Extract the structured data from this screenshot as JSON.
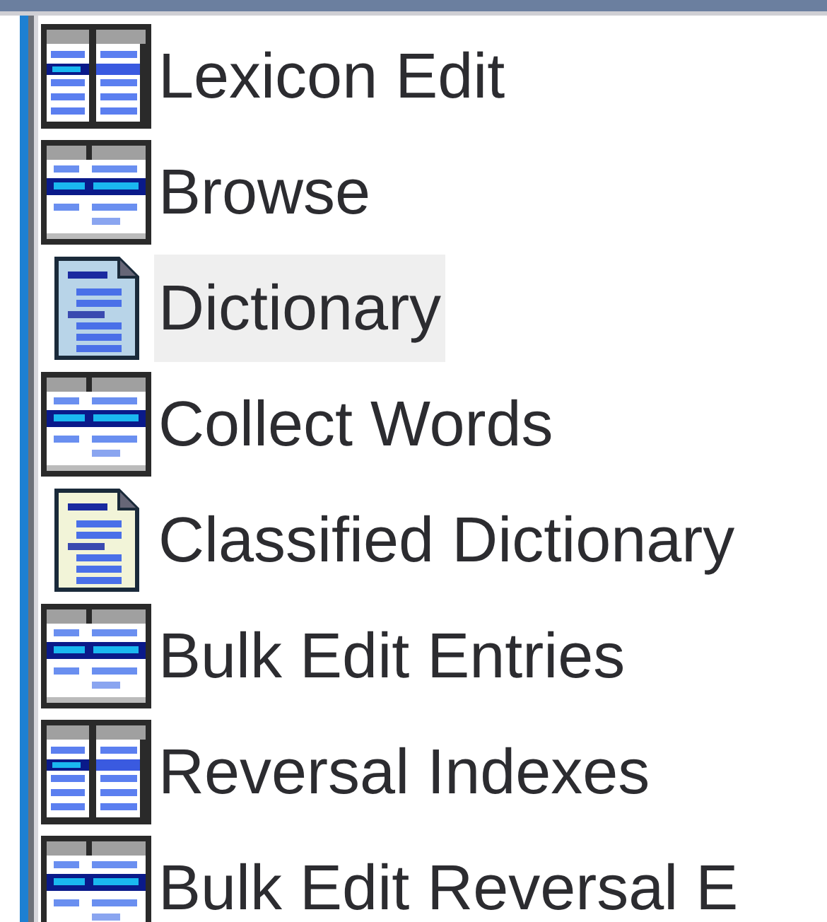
{
  "items": [
    {
      "label": "Lexicon Edit",
      "kind": "columns",
      "selected": false
    },
    {
      "label": "Browse",
      "kind": "rows",
      "selected": false
    },
    {
      "label": "Dictionary",
      "kind": "page",
      "selected": true
    },
    {
      "label": "Collect Words",
      "kind": "rows",
      "selected": false
    },
    {
      "label": "Classified Dictionary",
      "kind": "note-page",
      "selected": false
    },
    {
      "label": "Bulk Edit Entries",
      "kind": "rows",
      "selected": false
    },
    {
      "label": "Reversal Indexes",
      "kind": "columns",
      "selected": false
    },
    {
      "label": "Bulk Edit Reversal E",
      "kind": "rows",
      "selected": false
    }
  ]
}
